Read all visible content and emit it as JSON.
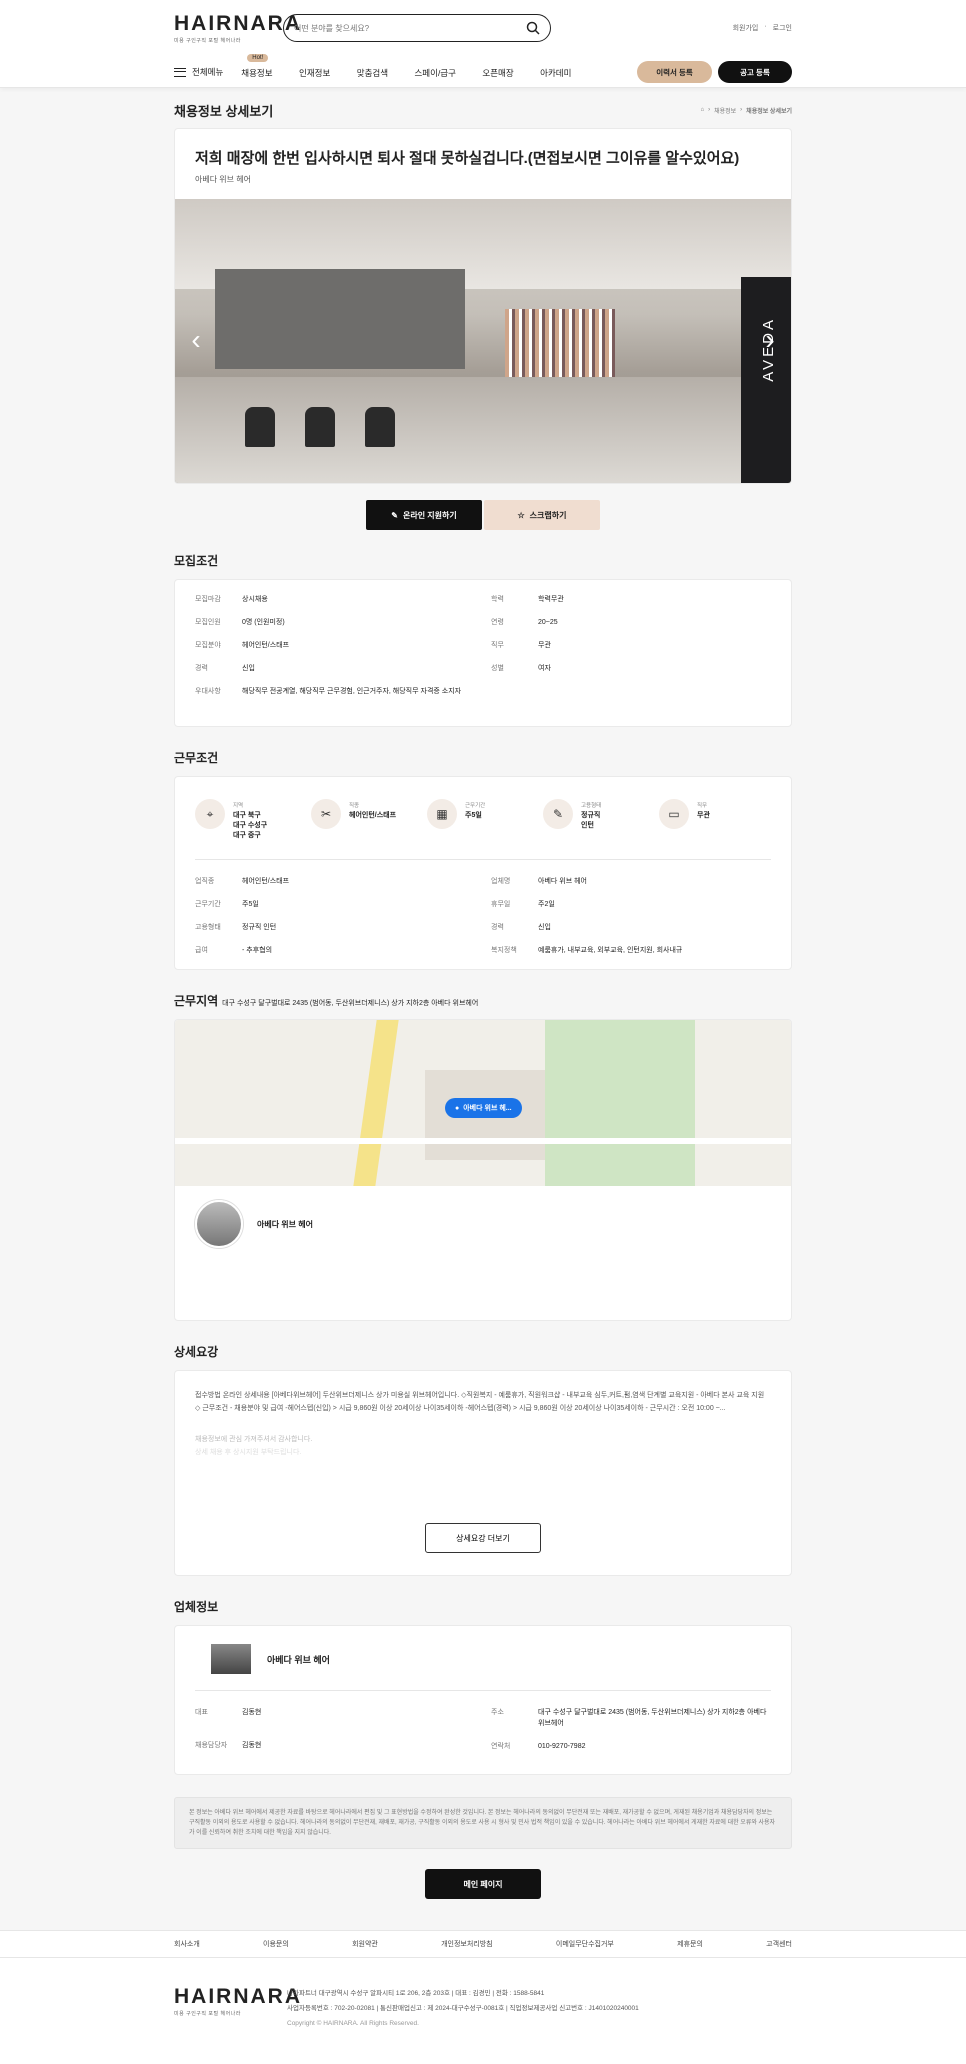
{
  "header": {
    "logo": "HAIRNARA",
    "logo_sub": "미용 구인구직 포털 헤어나라",
    "search_placeholder": "어떤 분야를 찾으세요?",
    "util": [
      "회원가입",
      "로그인"
    ],
    "all_menu": "전체메뉴",
    "nav": [
      "채용정보",
      "인재정보",
      "맞춤검색",
      "스페이/급구",
      "오픈매장",
      "아카데미"
    ],
    "btn_resume": "이력서 등록",
    "btn_post": "공고 등록"
  },
  "page": {
    "title": "채용정보 상세보기",
    "breadcrumb": [
      "채용정보",
      "채용정보 상세보기"
    ]
  },
  "job": {
    "title": "저희 매장에 한번 입사하시면 퇴사 절대 못하실겁니다.(면접보시면 그이유를 알수있어요)",
    "company": "아베다 위브 헤어",
    "photo_brand": "AVEDA",
    "apply": "온라인 지원하기",
    "scrap": "스크랩하기"
  },
  "recruit": {
    "title": "모집조건",
    "left": [
      {
        "k": "모집마감",
        "v": "상시채용"
      },
      {
        "k": "모집인원",
        "v": "0명 (인원미정)"
      },
      {
        "k": "모집분야",
        "v": "헤어인턴/스태프"
      },
      {
        "k": "경력",
        "v": "신입"
      },
      {
        "k": "우대사항",
        "v": "해당직무 전공계열, 해당직무 근무경험, 인근거주자, 해당직무 자격증 소지자"
      }
    ],
    "right": [
      {
        "k": "학력",
        "v": "학력무관"
      },
      {
        "k": "연령",
        "v": "20~25"
      },
      {
        "k": "직무",
        "v": "무관"
      },
      {
        "k": "성별",
        "v": "여자"
      }
    ]
  },
  "work": {
    "title": "근무조건",
    "icons": [
      {
        "l": "지역",
        "v": "대구 북구\n대구 수성구\n대구 중구"
      },
      {
        "l": "직종",
        "v": "헤어인턴/스태프"
      },
      {
        "l": "근무기간",
        "v": "주5일"
      },
      {
        "l": "고용형태",
        "v": "정규직\n인턴"
      },
      {
        "l": "직무",
        "v": "무관"
      }
    ],
    "left": [
      {
        "k": "업직종",
        "v": "헤어인턴/스태프"
      },
      {
        "k": "근무기간",
        "v": "주5일"
      },
      {
        "k": "고용형태",
        "v": "정규직 인턴"
      },
      {
        "k": "급여",
        "v": "- 추후협의"
      }
    ],
    "right": [
      {
        "k": "업체명",
        "v": "아베다 위브 헤어"
      },
      {
        "k": "휴무일",
        "v": "주2일"
      },
      {
        "k": "경력",
        "v": "신입"
      },
      {
        "k": "복지정책",
        "v": "예룸휴가, 내부교육, 외부교육, 인턴지원, 회사내규"
      }
    ]
  },
  "location": {
    "title": "근무지역",
    "address": "대구 수성구 달구벌대로 2435 (범어동, 두산위브더제니스) 상가 지하2층 아베다 위브헤어",
    "pin": "아베다 위브 헤...",
    "shop": "아베다 위브 헤어"
  },
  "detail": {
    "title": "상세요강",
    "text": "접수방법 온라인 상세내용 [아베다위브헤어] 두산위브더제니스 상가 미용실 위브헤어입니다. ◇직원복지 - 예룸휴가, 직원워크샵 - 내부교육 심두,커트,펌,염색 단계별 교육지원 - 아베다 본사 교육 지원 ◇ 근무조건 - 채용분야 및 급여 -헤어스텝(신입) > 시급 9,860원 이상 20세이상 나이35세이하 -헤어스텝(경력) > 시급 9,860원 이상 20세이상 나이35세이하 - 근무시간 : 오전 10:00 ~...",
    "fade1": "채용정보에 관심 가져주셔서 감사합니다.",
    "fade2": "상세 채용 후 상시지원 부탁드립니다.",
    "more": "상세요강 더보기"
  },
  "company": {
    "title": "업체정보",
    "name": "아베다 위브 헤어",
    "left": [
      {
        "k": "대표",
        "v": "김동현"
      },
      {
        "k": "채용담당자",
        "v": "김동현"
      }
    ],
    "right": [
      {
        "k": "주소",
        "v": "대구 수성구 달구벌대로 2435 (범어동, 두산위브더제니스) 상가 지하2층 아베다 위브헤어"
      },
      {
        "k": "연락처",
        "v": "010-9270-7982"
      }
    ]
  },
  "notice": "본 정보는 아베다 위브 헤어에서 제공한 자료를 바탕으로 헤어나라에서 편집 및 그 표현방법을 수정하여 완성한 것입니다. 본 정보는 헤어나라의 동의없이 무단전재 또는 재배포, 재가공할 수 없으며, 게재된 채용기업과 채용담당자의 정보는 구직활동 이외의 용도로 사용할 수 없습니다. 헤어나라의 동의없이 무단전재, 재배포, 재가공, 구직활동 이외의 용도로 사용 시 형사 및 민사 법적 책임이 있을 수 있습니다. 헤어나라는 아베다 위브 헤어에서 게재한 자료에 대한 오류와 사용자가 이를 신뢰하여 취한 조치에 대한 책임을 지지 않습니다.",
  "main_button": "메인 페이지",
  "footer": {
    "links": [
      "회사소개",
      "이용문의",
      "회원약관",
      "개인정보처리방침",
      "이메일무단수집거부",
      "제휴문의",
      "고객센터"
    ],
    "line1": "나라파트너   대구광역시 수성구 알파시티 1로 206, 2층 203호   |   대표 : 김경민   |   전화 : 1588-5841",
    "line2": "사업자등록번호 : 702-20-02081   |   통신판매업신고 : 제 2024-대구수성구-0081호   |   직업정보제공사업 신고번호 : J1401020240001",
    "copy": "Copyright © HAIRNARA. All Rights Reserved."
  }
}
